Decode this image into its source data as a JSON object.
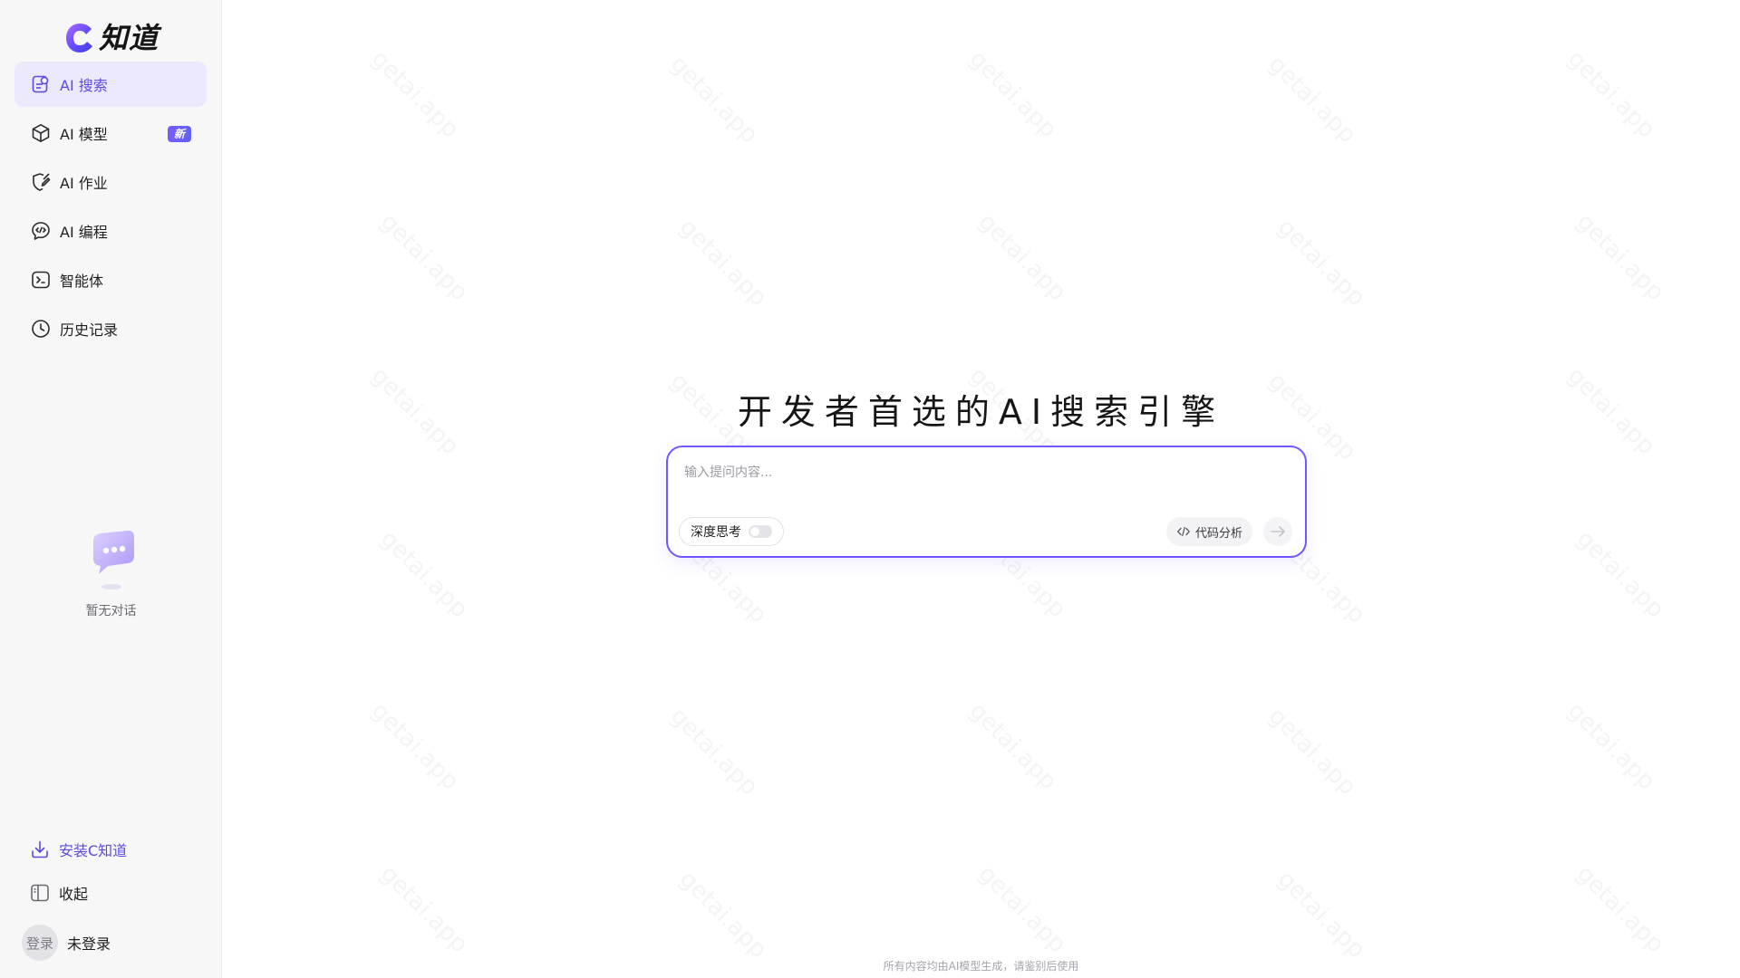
{
  "brand": {
    "name": "知道",
    "accent": "#6f58ff"
  },
  "sidebar": {
    "items": [
      {
        "label": "AI 搜索",
        "icon": "search-doc-icon",
        "active": true
      },
      {
        "label": "AI 模型",
        "icon": "cube-icon",
        "badge": "新"
      },
      {
        "label": "AI 作业",
        "icon": "shield-pen-icon"
      },
      {
        "label": "AI 编程",
        "icon": "code-chat-icon"
      },
      {
        "label": "智能体",
        "icon": "terminal-icon"
      },
      {
        "label": "历史记录",
        "icon": "clock-icon"
      }
    ],
    "empty_text": "暂无对话",
    "install_label": "安装C知道",
    "collapse_label": "收起",
    "user": {
      "avatar_text": "登录",
      "name": "未登录"
    }
  },
  "watermark_text": "getai.app",
  "main": {
    "headline": "开发者首选的AI搜索引擎",
    "search": {
      "placeholder": "输入提问内容...",
      "deep_think_label": "深度思考",
      "deep_think_on": false,
      "code_label": "代码分析"
    },
    "footer": "所有内容均由AI模型生成，请鉴别后使用"
  }
}
